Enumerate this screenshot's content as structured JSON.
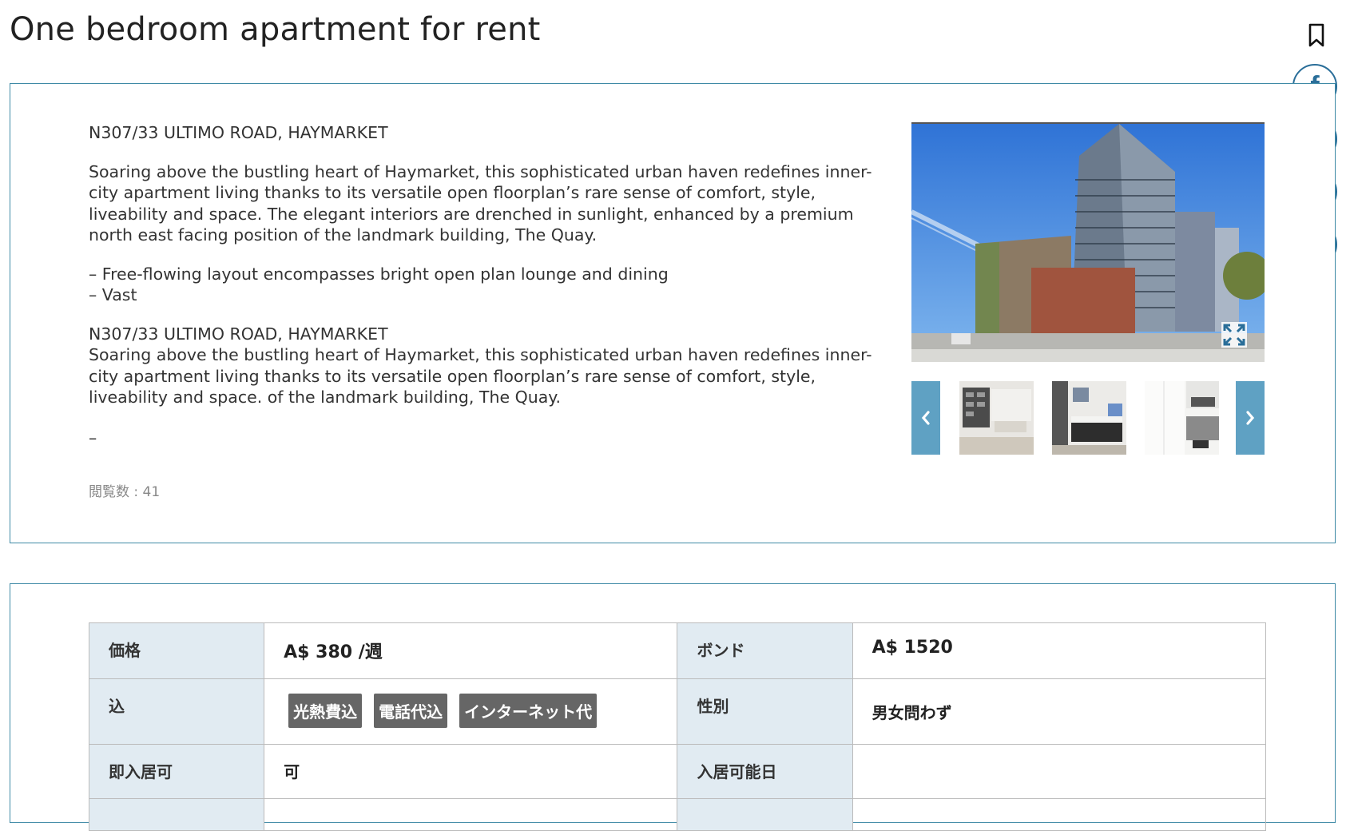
{
  "page": {
    "title": "One bedroom apartment for rent"
  },
  "description": {
    "address1": "N307/33 ULTIMO ROAD, HAYMARKET",
    "para1": "Soaring above the bustling heart of Haymarket, this sophisticated urban haven redefines inner-city apartment living thanks to its versatile open floorplan’s rare sense of comfort, style, liveability and space. The elegant interiors are drenched in sunlight, enhanced by a premium north east facing position of the landmark building, The Quay.",
    "bullet1": "– Free-flowing layout encompasses bright open plan lounge and dining",
    "bullet2": "– Vast",
    "address2": "N307/33 ULTIMO ROAD, HAYMARKET",
    "para2": "Soaring above the bustling heart of Haymarket, this sophisticated urban haven redefines inner-city apartment living thanks to its versatile open floorplan’s rare sense of comfort, style, liveability and space. of the landmark building, The Quay.",
    "dash": "–",
    "views": "閲覧数 : 41"
  },
  "gallery": {
    "main_photo": "building-exterior-photo",
    "thumbnails": [
      "living-room-thumb",
      "bedroom-thumb",
      "kitchen-thumb"
    ],
    "prev_icon": "chevron-left-icon",
    "next_icon": "chevron-right-icon",
    "expand_icon": "expand-icon"
  },
  "share": {
    "icons": [
      "facebook-icon",
      "instagram-icon",
      "twitter-icon",
      "mail-icon"
    ],
    "color": "#2a6e99",
    "facebook_glyph": "f"
  },
  "details": {
    "price_label": "価格",
    "price_value": "A$ 380 /週",
    "bond_label": "ボンド",
    "bond_value": "A$ 1520",
    "included_label": "込",
    "included_tags": [
      "光熱費込",
      "電話代込",
      "インターネット代"
    ],
    "gender_label": "性別",
    "gender_value": "男女問わず",
    "immediate_label": "即入居可",
    "immediate_value": "可",
    "available_label": "入居可能日",
    "available_value": ""
  },
  "colors": {
    "panel_border": "#3f8aa6",
    "header_cell": "#e1ebf2",
    "arrow_bg": "#5fa1c3",
    "tag_bg": "#666666"
  }
}
